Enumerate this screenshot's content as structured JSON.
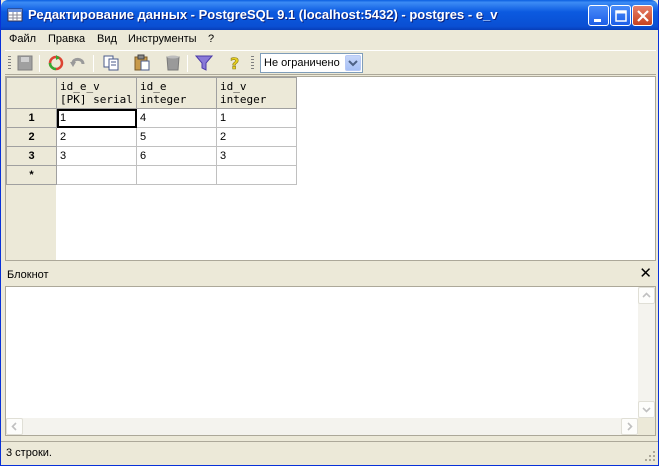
{
  "window": {
    "title": "Редактирование данных - PostgreSQL 9.1 (localhost:5432) - postgres - e_v"
  },
  "menu": [
    {
      "label": "Файл"
    },
    {
      "label": "Правка"
    },
    {
      "label": "Вид"
    },
    {
      "label": "Инструменты"
    },
    {
      "label": "?"
    }
  ],
  "toolbar": {
    "icons": [
      "save-icon",
      "refresh-icon",
      "undo-icon",
      "copy-icon",
      "paste-icon",
      "delete-icon",
      "filter-icon",
      "help-icon"
    ],
    "limit_value": "Не ограничено"
  },
  "grid": {
    "columns": [
      {
        "name": "id_e_v",
        "type": "[PK] serial"
      },
      {
        "name": "id_e",
        "type": "integer"
      },
      {
        "name": "id_v",
        "type": "integer"
      }
    ],
    "rows": [
      {
        "num": "1",
        "cells": [
          "1",
          "4",
          "1"
        ]
      },
      {
        "num": "2",
        "cells": [
          "2",
          "5",
          "2"
        ]
      },
      {
        "num": "3",
        "cells": [
          "3",
          "6",
          "3"
        ]
      }
    ],
    "new_row_marker": "*"
  },
  "notepad": {
    "title": "Блокнот",
    "close": "✕",
    "content": ""
  },
  "status": {
    "text": "3 строки."
  },
  "colors": {
    "titlebar": "#0a5fe0",
    "window_bg": "#ece9d8",
    "grid_line": "#c0c0c0"
  }
}
